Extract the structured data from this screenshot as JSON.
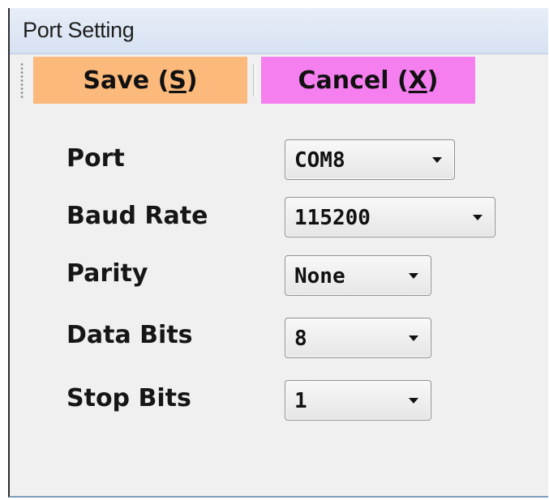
{
  "window": {
    "title": "Port Setting"
  },
  "toolbar": {
    "save": {
      "text": "Save (",
      "key": "S",
      "close": ")",
      "color": "#fbb97c"
    },
    "cancel": {
      "text": "Cancel (",
      "key": "X",
      "close": ")",
      "color": "#f67ff0"
    }
  },
  "settings": {
    "port": {
      "label": "Port",
      "value": "COM8"
    },
    "baud_rate": {
      "label": "Baud Rate",
      "value": "115200"
    },
    "parity": {
      "label": "Parity",
      "value": "None"
    },
    "data_bits": {
      "label": "Data Bits",
      "value": "8"
    },
    "stop_bits": {
      "label": "Stop Bits",
      "value": "1"
    }
  },
  "icons": {
    "dropdown": "chevron-down-icon",
    "grip": "toolbar-grip-icon"
  }
}
